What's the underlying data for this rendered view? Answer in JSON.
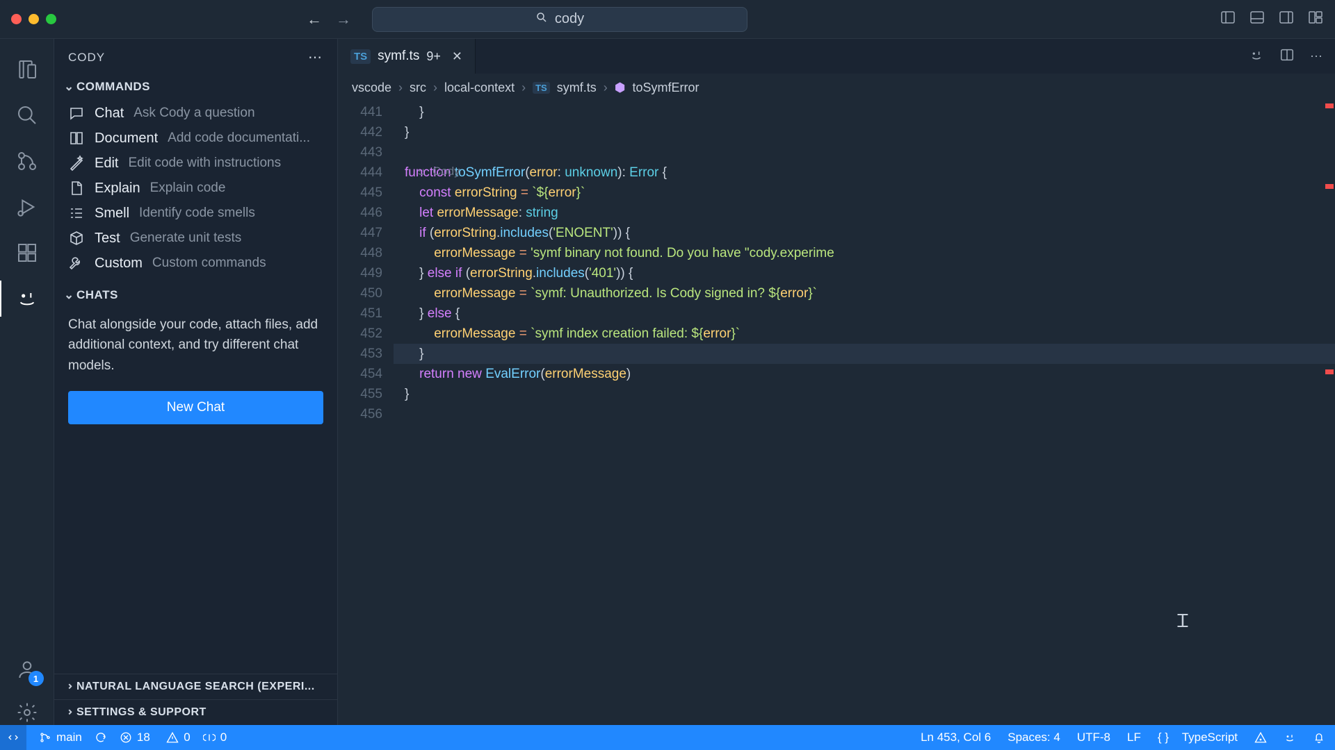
{
  "titlebar": {
    "search": "cody"
  },
  "sidebar": {
    "title": "CODY",
    "sections": {
      "commands": {
        "label": "COMMANDS"
      },
      "chats": {
        "label": "CHATS"
      },
      "nls": {
        "label": "NATURAL LANGUAGE SEARCH (EXPERI..."
      },
      "settings": {
        "label": "SETTINGS & SUPPORT"
      }
    },
    "commands": [
      {
        "label": "Chat",
        "desc": "Ask Cody a question"
      },
      {
        "label": "Document",
        "desc": "Add code documentati..."
      },
      {
        "label": "Edit",
        "desc": "Edit code with instructions"
      },
      {
        "label": "Explain",
        "desc": "Explain code"
      },
      {
        "label": "Smell",
        "desc": "Identify code smells"
      },
      {
        "label": "Test",
        "desc": "Generate unit tests"
      },
      {
        "label": "Custom",
        "desc": "Custom commands"
      }
    ],
    "chats_text": "Chat alongside your code, attach files, add additional context, and try different chat models.",
    "new_chat": "New Chat"
  },
  "activity": {
    "badge": "1"
  },
  "editor": {
    "tab_name": "symf.ts",
    "tab_dirty": "9+",
    "breadcrumb": [
      "vscode",
      "src",
      "local-context",
      "symf.ts",
      "toSymfError"
    ],
    "hint_label": "Cody",
    "line_numbers": [
      "441",
      "442",
      "443",
      "444",
      "445",
      "446",
      "447",
      "448",
      "449",
      "450",
      "451",
      "452",
      "453",
      "454",
      "455",
      "456"
    ]
  },
  "statusbar": {
    "branch": "main",
    "errors": "18",
    "warnings": "0",
    "ports": "0",
    "position": "Ln 453, Col 6",
    "spaces": "Spaces: 4",
    "encoding": "UTF-8",
    "eol": "LF",
    "language": "TypeScript"
  }
}
